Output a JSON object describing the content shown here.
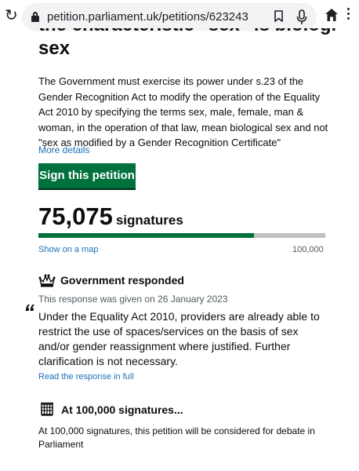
{
  "browser": {
    "url": "petition.parliament.uk/petitions/623243",
    "icons": [
      "reload-icon",
      "lock-icon",
      "bookmark-icon",
      "microphone-icon",
      "home-icon",
      "more-menu-icon"
    ]
  },
  "petition": {
    "title_line1": "the characteristic \"sex\" is biological",
    "title_line2": "sex",
    "description": "The Government must exercise its power under s.23 of the Gender Recognition Act to modify the operation of the Equality Act 2010 by specifying the terms sex, male, female, man & woman, in the operation of that law, mean biological sex and not \"sex as modified by a Gender Recognition Certificate\"",
    "more_details": "More details",
    "sign_button": "Sign this petition"
  },
  "signatures": {
    "count": "75,075",
    "label": "signatures",
    "progress_fraction": 0.75075,
    "show_map": "Show on a map",
    "target": "100,000"
  },
  "response": {
    "heading": "Government responded",
    "date_text": "This response was given on 26 January 2023",
    "quote_mark": "“",
    "summary": "Under the Equality Act 2010, providers are already able to restrict the use of spaces/services on the basis of sex and/or gender reassignment where justified. Further clarification is not necessary.",
    "read_link": "Read the response in full"
  },
  "debate": {
    "heading": "At 100,000 signatures...",
    "text": "At 100,000 signatures, this petition will be considered for debate in Parliament"
  },
  "colors": {
    "green": "#00703c",
    "link": "#1d70b8",
    "secondary_text": "#505a5f",
    "progress_track": "#bfc1c3"
  }
}
